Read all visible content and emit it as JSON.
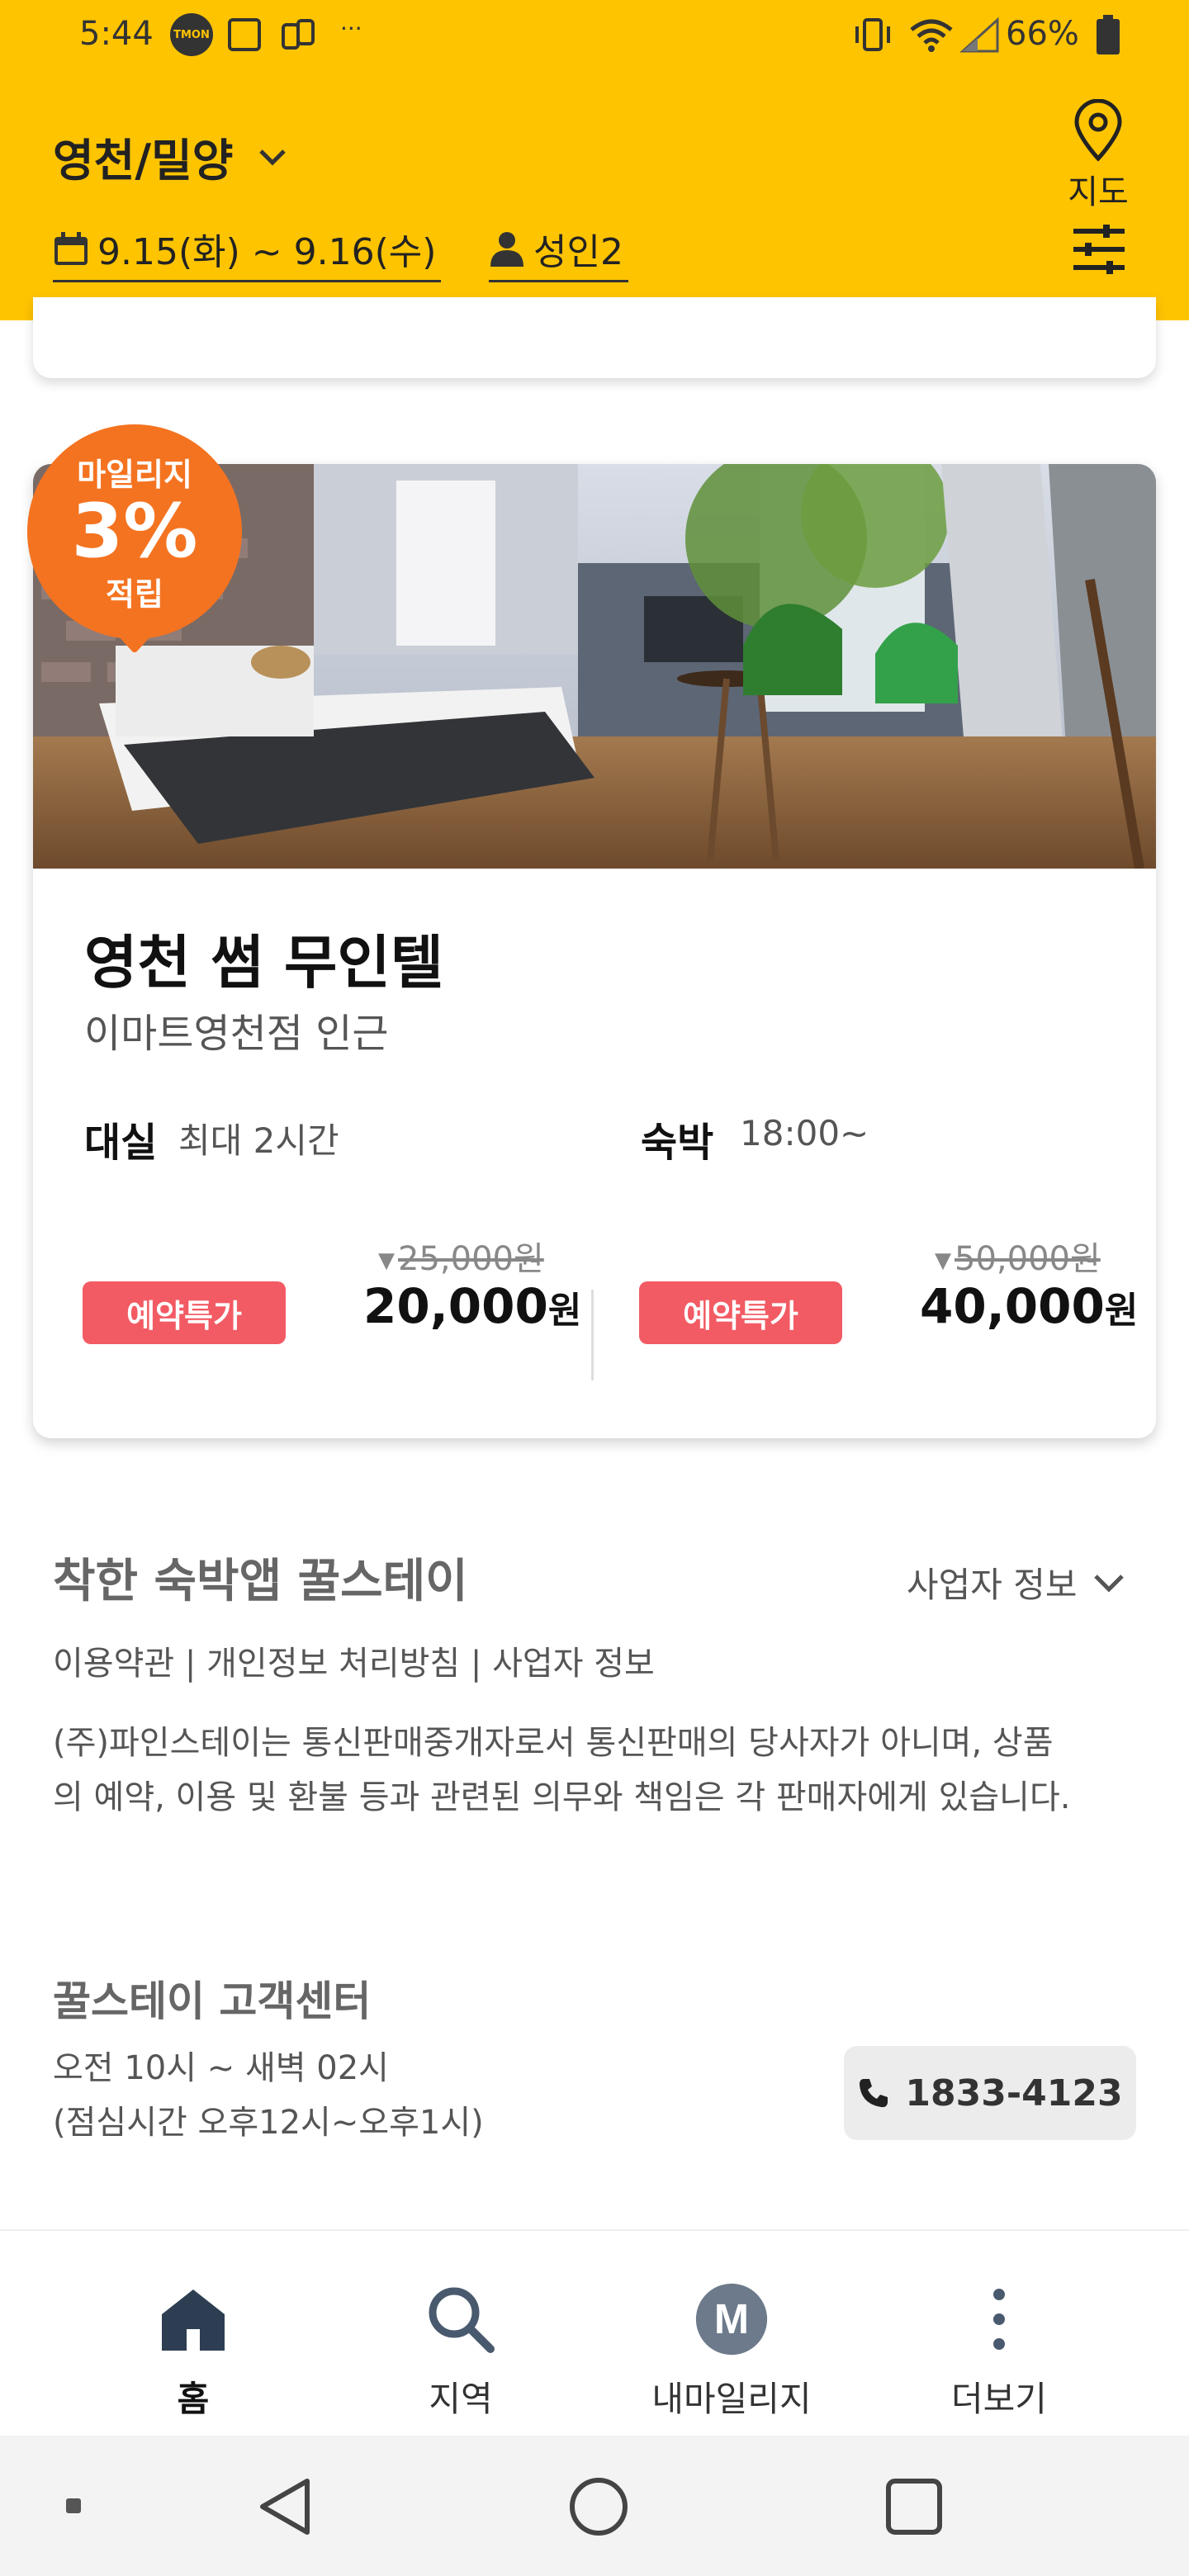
{
  "status_bar": {
    "time": "5:44",
    "app_badge": "TMON",
    "battery": "66%"
  },
  "header": {
    "region": "영천/밀양",
    "dates": "9.15(화) ~ 9.16(수)",
    "guests": "성인2",
    "map_label": "지도",
    "accent_color": "#FFC400"
  },
  "listing": {
    "badge": {
      "line1": "마일리지",
      "line2": "3%",
      "line3": "적립",
      "color": "#F47321"
    },
    "name": "영천 썸 무인텔",
    "location": "이마트영천점 인근",
    "short_stay": {
      "label": "대실",
      "detail": "최대 2시간",
      "original_price": "25,000원",
      "promo": "예약특가",
      "price_number": "20,000",
      "price_unit": "원"
    },
    "overnight": {
      "label": "숙박",
      "detail": "18:00~",
      "original_price": "50,000원",
      "promo": "예약특가",
      "price_number": "40,000",
      "price_unit": "원"
    }
  },
  "footer": {
    "title": "착한 숙박앱 꿀스테이",
    "business_info_toggle": "사업자 정보",
    "links": "이용약관 | 개인정보 처리방침 | 사업자 정보",
    "disclaimer": "(주)파인스테이는 통신판매중개자로서 통신판매의 당사자가 아니며, 상품의 예약, 이용 및 환불 등과 관련된 의무와 책임은 각 판매자에게 있습니다.",
    "cs_title": "꿀스테이 고객센터",
    "cs_hours_line1": "오전 10시 ~ 새벽 02시",
    "cs_hours_line2": "(점심시간 오후12시~오후1시)",
    "cs_phone": "1833-4123"
  },
  "bottom_nav": {
    "items": [
      {
        "label": "홈",
        "icon": "home-icon",
        "active": true
      },
      {
        "label": "지역",
        "icon": "search-icon",
        "active": false
      },
      {
        "label": "내마일리지",
        "icon": "mileage-icon",
        "active": false
      },
      {
        "label": "더보기",
        "icon": "more-icon",
        "active": false
      }
    ]
  },
  "system_nav": {
    "icons": [
      "back-icon",
      "home-circle-icon",
      "recents-icon"
    ]
  }
}
